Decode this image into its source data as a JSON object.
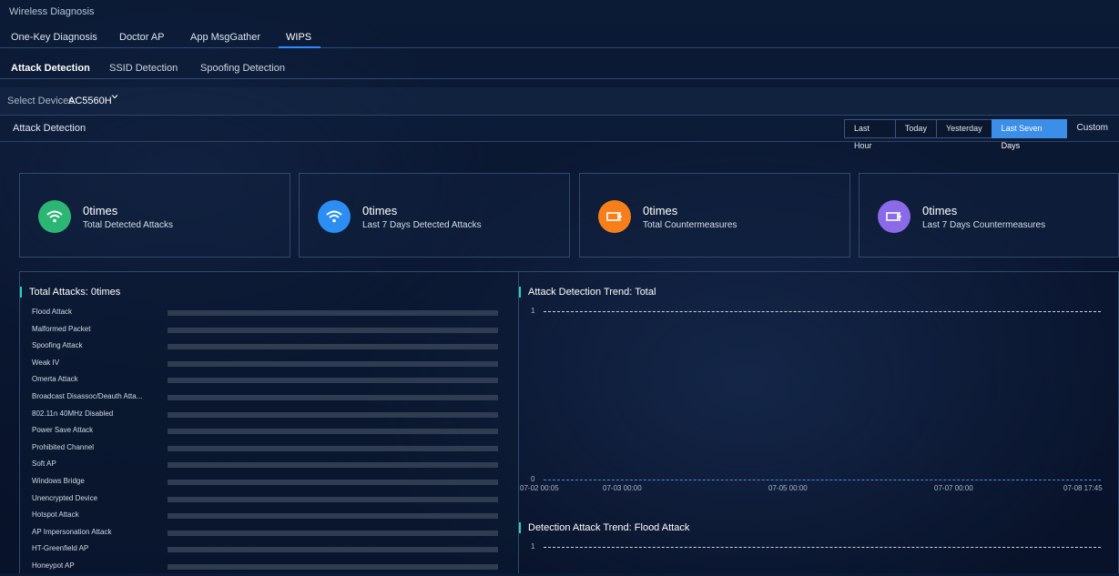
{
  "app": {
    "title": "Wireless Diagnosis"
  },
  "tabs": [
    {
      "label": "One-Key Diagnosis"
    },
    {
      "label": "Doctor AP"
    },
    {
      "label": "App MsgGather"
    },
    {
      "label": "WIPS"
    }
  ],
  "subtabs": [
    {
      "label": "Attack Detection"
    },
    {
      "label": "SSID Detection"
    },
    {
      "label": "Spoofing Detection"
    }
  ],
  "device": {
    "label": "Select Devices:",
    "value": "AC5560H"
  },
  "section": {
    "title": "Attack Detection"
  },
  "ranges": [
    {
      "label": "Last Hour"
    },
    {
      "label": "Today"
    },
    {
      "label": "Yesterday"
    },
    {
      "label": "Last Seven Days"
    },
    {
      "label": "Custom"
    }
  ],
  "cards": [
    {
      "value": "0times",
      "label": "Total Detected Attacks",
      "color": "#2bb673",
      "icon": "wifi-icon"
    },
    {
      "value": "0times",
      "label": "Last 7 Days Detected Attacks",
      "color": "#2c8ef2",
      "icon": "wifi-icon"
    },
    {
      "value": "0times",
      "label": "Total Countermeasures",
      "color": "#f77f1a",
      "icon": "countermeasure-icon"
    },
    {
      "value": "0times",
      "label": "Last 7 Days Countermeasures",
      "color": "#8a6ae8",
      "icon": "countermeasure-icon"
    }
  ],
  "attacks": {
    "title": "Total Attacks: 0times",
    "items": [
      "Flood Attack",
      "Malformed Packet",
      "Spoofing Attack",
      "Weak IV",
      "Omerta Attack",
      "Broadcast Disassoc/Deauth Atta...",
      "802.11n 40MHz Disabled",
      "Power Save Attack",
      "Prohibited Channel",
      "Soft AP",
      "Windows Bridge",
      "Unencrypted Device",
      "Hotspot Attack",
      "AP Impersonation Attack",
      "HT-Greenfield AP",
      "Honeypot AP"
    ]
  },
  "trend_total": {
    "title": "Attack Detection Trend: Total",
    "y_ticks": [
      "1",
      "0"
    ],
    "x_ticks": [
      "07-02 00:05",
      "07-03 00:00",
      "07-05 00:00",
      "07-07 00:00",
      "07-08 17:45"
    ]
  },
  "trend_flood": {
    "title": "Detection Attack Trend: Flood Attack",
    "y_ticks": [
      "1"
    ]
  }
}
